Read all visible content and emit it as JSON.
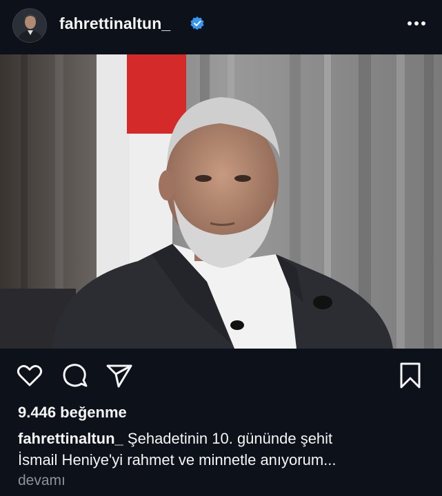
{
  "header": {
    "username": "fahrettinaltun_",
    "verified_color": "#3897f0",
    "more_icon": "more-horizontal-icon"
  },
  "post": {
    "photo_description_icon": "post-photo",
    "actions": {
      "like_icon": "heart-icon",
      "comment_icon": "comment-icon",
      "share_icon": "send-icon",
      "save_icon": "bookmark-icon"
    },
    "likes_text": "9.446 beğenme",
    "caption_user": "fahrettinaltun_",
    "caption_line1": "Şehadetinin 10. gününde şehit",
    "caption_line2": "İsmail Heniye'yi rahmet ve minnetle anıyorum...",
    "more_label": "devamı"
  },
  "colors": {
    "background": "#0c111a",
    "text": "#f5f5f5",
    "muted": "#8e939b"
  }
}
